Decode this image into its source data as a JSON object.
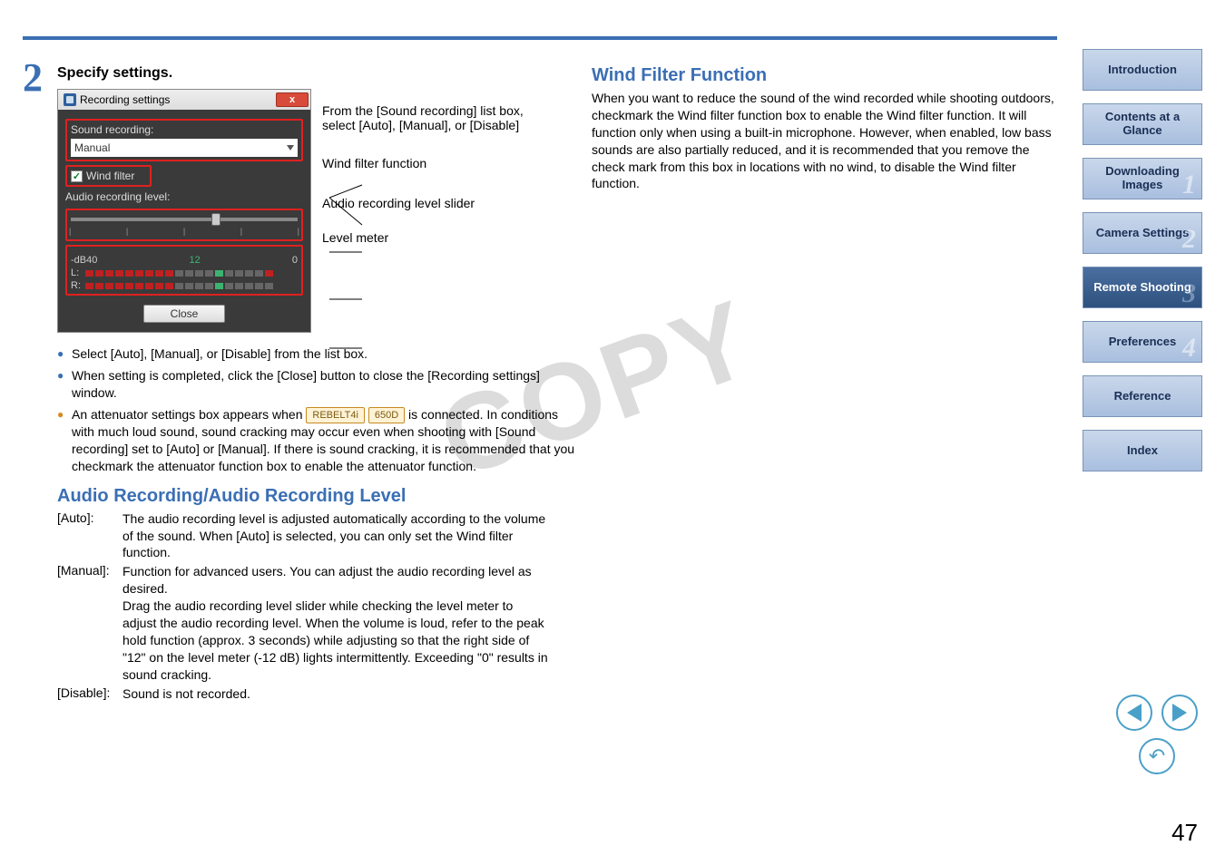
{
  "step": {
    "number": "2",
    "title": "Specify settings."
  },
  "screenshot": {
    "window_title": "Recording settings",
    "label_sound_recording": "Sound recording:",
    "dropdown_value": "Manual",
    "wind_filter_label": "Wind filter",
    "audio_level_label": "Audio recording level:",
    "db_left": "-dB40",
    "db_mid": "12",
    "db_right": "0",
    "meter_L": "L:",
    "meter_R": "R:",
    "close_btn": "Close"
  },
  "callouts": {
    "c1": "From the [Sound recording] list box, select [Auto], [Manual], or [Disable]",
    "c2": "Wind filter function",
    "c3": "Audio recording level slider",
    "c4": "Level meter"
  },
  "bullets": {
    "b1": "Select [Auto], [Manual], or [Disable] from the list box.",
    "b2": " When setting is completed, click the [Close] button to close the [Recording settings] window.",
    "b3_pre": "An attenuator settings box appears when ",
    "badge1": "REBELT4i",
    "badge2": "650D",
    "b3_post": " is connected. In conditions with much loud sound, sound cracking may occur even when shooting with [Sound recording] set to [Auto] or [Manual]. If there is sound cracking, it is recommended that you checkmark the attenuator function box to enable the attenuator function."
  },
  "section2": {
    "heading": "Audio Recording/Audio Recording Level",
    "auto_lbl": "[Auto]:",
    "auto_desc": "The audio recording level is adjusted automatically according to the volume of the sound. When [Auto] is selected, you can only set the Wind filter function.",
    "manual_lbl": "[Manual]:",
    "manual_desc": "Function for advanced users. You can adjust the audio recording level as desired.\nDrag the audio recording level slider while checking the level meter to adjust the audio recording level. When the volume is loud, refer to the peak hold function (approx. 3 seconds) while adjusting so that the right side of \"12\" on the level meter (-12 dB) lights intermittently. Exceeding \"0\" results in sound cracking.",
    "disable_lbl": "[Disable]:",
    "disable_desc": "Sound is not recorded."
  },
  "right": {
    "heading": "Wind Filter Function",
    "para": "When you want to reduce the sound of the wind recorded while shooting outdoors, checkmark the Wind filter function box to enable the Wind filter function. It will function only when using a built-in microphone. However, when enabled, low bass sounds are also partially reduced, and it is recommended that you remove the check mark from this box in locations with no wind, to disable the Wind filter function."
  },
  "sidebar": {
    "items": [
      {
        "label": "Introduction",
        "ghost": "",
        "active": false
      },
      {
        "label": "Contents at a Glance",
        "ghost": "",
        "active": false
      },
      {
        "label": "Downloading Images",
        "ghost": "1",
        "active": false
      },
      {
        "label": "Camera Settings",
        "ghost": "2",
        "active": false
      },
      {
        "label": "Remote Shooting",
        "ghost": "3",
        "active": true
      },
      {
        "label": "Preferences",
        "ghost": "4",
        "active": false
      },
      {
        "label": "Reference",
        "ghost": "",
        "active": false
      },
      {
        "label": "Index",
        "ghost": "",
        "active": false
      }
    ]
  },
  "watermark": "COPY",
  "page_number": "47"
}
